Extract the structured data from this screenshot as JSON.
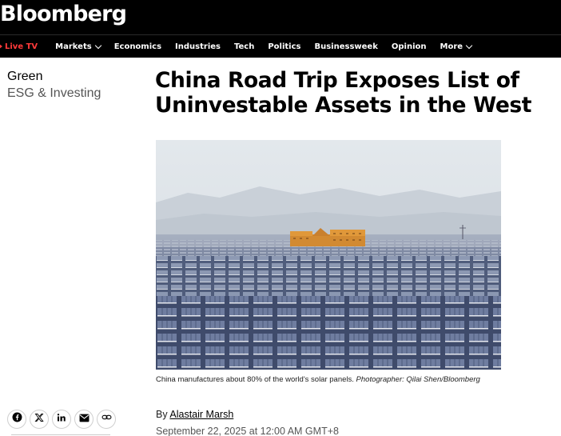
{
  "brand": {
    "logo": "Bloomberg"
  },
  "nav": {
    "live": "Live TV",
    "items": [
      "Markets",
      "Economics",
      "Industries",
      "Tech",
      "Politics",
      "Businessweek",
      "Opinion",
      "More"
    ]
  },
  "section": {
    "name": "Green",
    "sub": "ESG & Investing"
  },
  "article": {
    "headline": "China Road Trip Exposes List of Uninvestable Assets in the West",
    "caption": "China manufactures about 80% of the world's solar panels.",
    "credit": "Photographer: Qilai Shen/Bloomberg",
    "byline_prefix": "By",
    "author": "Alastair Marsh",
    "date": "September 22, 2025 at 12:00 AM GMT+8"
  },
  "share_icons": [
    "facebook-icon",
    "x-icon",
    "linkedin-icon",
    "email-icon",
    "link-icon"
  ],
  "colors": {
    "live": "#ff3a3a",
    "topbar": "#000000",
    "building": "#e0983a"
  }
}
